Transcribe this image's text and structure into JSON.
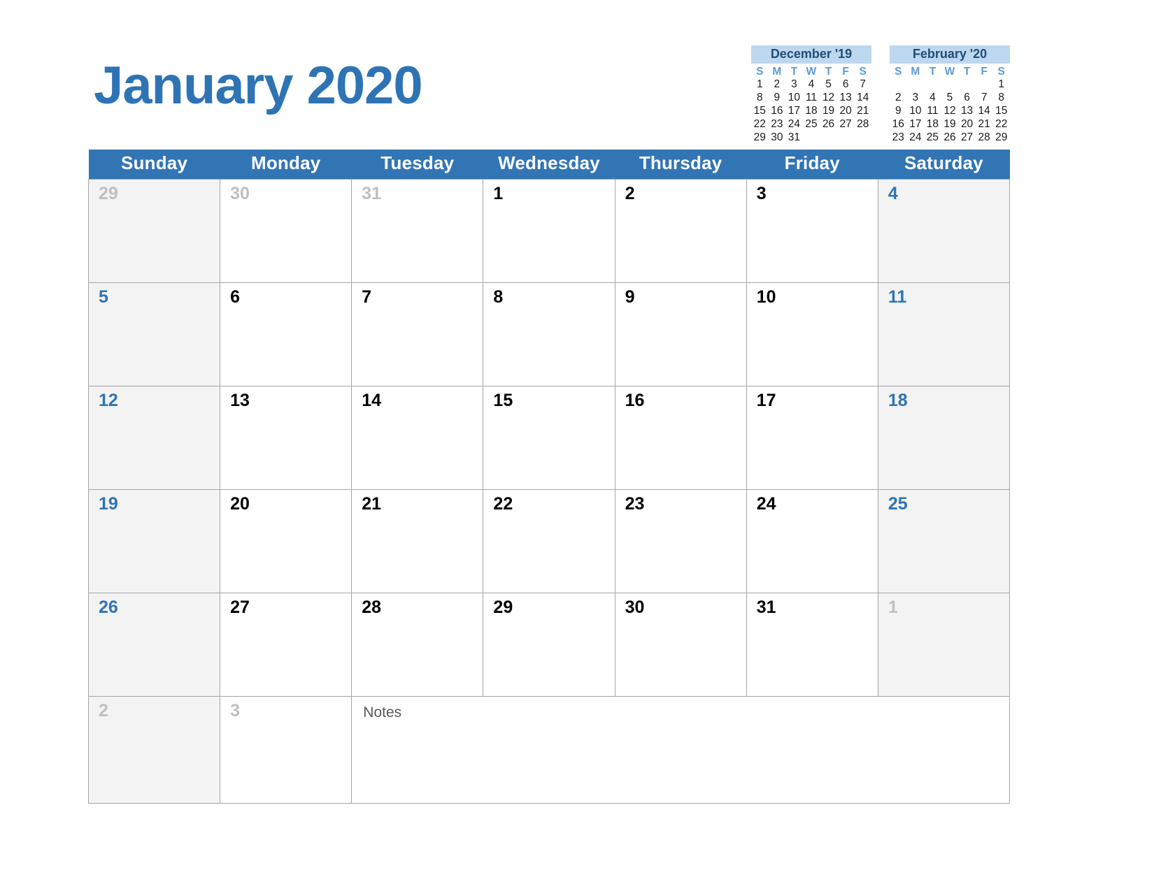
{
  "title": "January 2020",
  "colors": {
    "title_blue": "#2e74b5",
    "header_bar_blue": "#3275b5",
    "mini_header_band": "#bdd7ee",
    "mini_header_text": "#1f4e79",
    "mini_dow_blue": "#5b9bd5",
    "weekend_cell_bg": "#f3f3f3",
    "out_of_month_gray": "#bfbfbf",
    "grid_line": "#a6a6a6"
  },
  "weekday_headers": [
    "Sunday",
    "Monday",
    "Tuesday",
    "Wednesday",
    "Thursday",
    "Friday",
    "Saturday"
  ],
  "mini_calendars": [
    {
      "title": "December '19",
      "dow": [
        "S",
        "M",
        "T",
        "W",
        "T",
        "F",
        "S"
      ],
      "weeks": [
        [
          "1",
          "2",
          "3",
          "4",
          "5",
          "6",
          "7"
        ],
        [
          "8",
          "9",
          "10",
          "11",
          "12",
          "13",
          "14"
        ],
        [
          "15",
          "16",
          "17",
          "18",
          "19",
          "20",
          "21"
        ],
        [
          "22",
          "23",
          "24",
          "25",
          "26",
          "27",
          "28"
        ],
        [
          "29",
          "30",
          "31",
          "",
          "",
          "",
          ""
        ]
      ]
    },
    {
      "title": "February '20",
      "dow": [
        "S",
        "M",
        "T",
        "W",
        "T",
        "F",
        "S"
      ],
      "weeks": [
        [
          "",
          "",
          "",
          "",
          "",
          "",
          "1"
        ],
        [
          "2",
          "3",
          "4",
          "5",
          "6",
          "7",
          "8"
        ],
        [
          "9",
          "10",
          "11",
          "12",
          "13",
          "14",
          "15"
        ],
        [
          "16",
          "17",
          "18",
          "19",
          "20",
          "21",
          "22"
        ],
        [
          "23",
          "24",
          "25",
          "26",
          "27",
          "28",
          "29"
        ]
      ]
    }
  ],
  "weeks": [
    [
      {
        "n": "29",
        "out": true,
        "weekend": true
      },
      {
        "n": "30",
        "out": true,
        "weekend": false
      },
      {
        "n": "31",
        "out": true,
        "weekend": false
      },
      {
        "n": "1",
        "out": false,
        "weekend": false
      },
      {
        "n": "2",
        "out": false,
        "weekend": false
      },
      {
        "n": "3",
        "out": false,
        "weekend": false
      },
      {
        "n": "4",
        "out": false,
        "weekend": true
      }
    ],
    [
      {
        "n": "5",
        "out": false,
        "weekend": true
      },
      {
        "n": "6",
        "out": false,
        "weekend": false
      },
      {
        "n": "7",
        "out": false,
        "weekend": false
      },
      {
        "n": "8",
        "out": false,
        "weekend": false
      },
      {
        "n": "9",
        "out": false,
        "weekend": false
      },
      {
        "n": "10",
        "out": false,
        "weekend": false
      },
      {
        "n": "11",
        "out": false,
        "weekend": true
      }
    ],
    [
      {
        "n": "12",
        "out": false,
        "weekend": true
      },
      {
        "n": "13",
        "out": false,
        "weekend": false
      },
      {
        "n": "14",
        "out": false,
        "weekend": false
      },
      {
        "n": "15",
        "out": false,
        "weekend": false
      },
      {
        "n": "16",
        "out": false,
        "weekend": false
      },
      {
        "n": "17",
        "out": false,
        "weekend": false
      },
      {
        "n": "18",
        "out": false,
        "weekend": true
      }
    ],
    [
      {
        "n": "19",
        "out": false,
        "weekend": true
      },
      {
        "n": "20",
        "out": false,
        "weekend": false
      },
      {
        "n": "21",
        "out": false,
        "weekend": false
      },
      {
        "n": "22",
        "out": false,
        "weekend": false
      },
      {
        "n": "23",
        "out": false,
        "weekend": false
      },
      {
        "n": "24",
        "out": false,
        "weekend": false
      },
      {
        "n": "25",
        "out": false,
        "weekend": true
      }
    ],
    [
      {
        "n": "26",
        "out": false,
        "weekend": true
      },
      {
        "n": "27",
        "out": false,
        "weekend": false
      },
      {
        "n": "28",
        "out": false,
        "weekend": false
      },
      {
        "n": "29",
        "out": false,
        "weekend": false
      },
      {
        "n": "30",
        "out": false,
        "weekend": false
      },
      {
        "n": "31",
        "out": false,
        "weekend": false
      },
      {
        "n": "1",
        "out": true,
        "weekend": true
      }
    ]
  ],
  "notes_row": {
    "day_cells": [
      {
        "n": "2",
        "out": true,
        "weekend": true
      },
      {
        "n": "3",
        "out": true,
        "weekend": false
      }
    ],
    "notes_label": "Notes"
  }
}
